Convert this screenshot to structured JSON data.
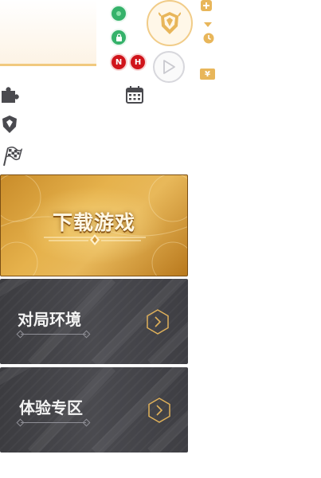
{
  "colors": {
    "accent_gold": "#e8b65a",
    "status_green": "#35b26a",
    "status_red": "#d0141b",
    "dark_panel": "#45454a"
  },
  "status": {
    "badge_n": "N",
    "badge_h": "H",
    "yen_symbol": "¥"
  },
  "icons": {
    "plus": "plus-icon",
    "dropdown": "caret-down-icon",
    "clock": "clock-icon",
    "lock": "lock-icon",
    "play": "play-icon",
    "puzzle": "puzzle-icon",
    "calendar": "calendar-icon",
    "helmet": "helmet-icon",
    "flag": "checkered-flag-icon"
  },
  "banners": {
    "download": "下载游戏",
    "environment": "对局环境",
    "experience": "体验专区"
  }
}
